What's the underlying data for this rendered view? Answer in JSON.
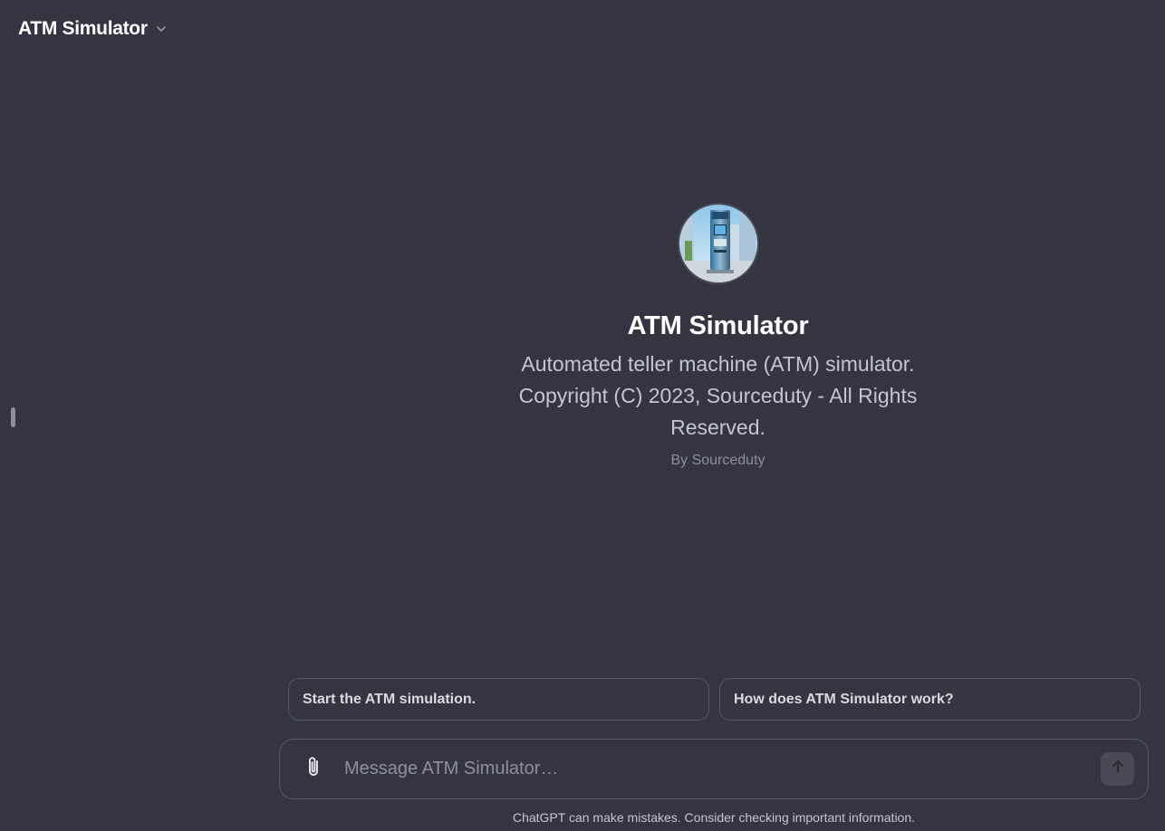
{
  "header": {
    "title": "ATM Simulator",
    "dropdown_icon": "chevron-down-icon"
  },
  "sidebar": {
    "toggle_icon": "sidebar-handle"
  },
  "gpt": {
    "name": "ATM Simulator",
    "description": "Automated teller machine (ATM) simulator. Copyright (C) 2023, Sourceduty - All Rights Reserved.",
    "author": "By Sourceduty",
    "avatar_icon": "atm-machine-image"
  },
  "suggestions": [
    {
      "label": "Start the ATM simulation."
    },
    {
      "label": "How does ATM Simulator work?"
    }
  ],
  "composer": {
    "placeholder": "Message ATM Simulator…",
    "attach_icon": "paperclip-icon",
    "send_icon": "arrow-up-icon"
  },
  "footer": {
    "disclaimer": "ChatGPT can make mistakes. Consider checking important information."
  },
  "colors": {
    "background": "#343541",
    "border": "#565869",
    "text_primary": "#ffffff",
    "text_secondary": "#c5c5d2",
    "text_muted": "#8e8ea0"
  }
}
